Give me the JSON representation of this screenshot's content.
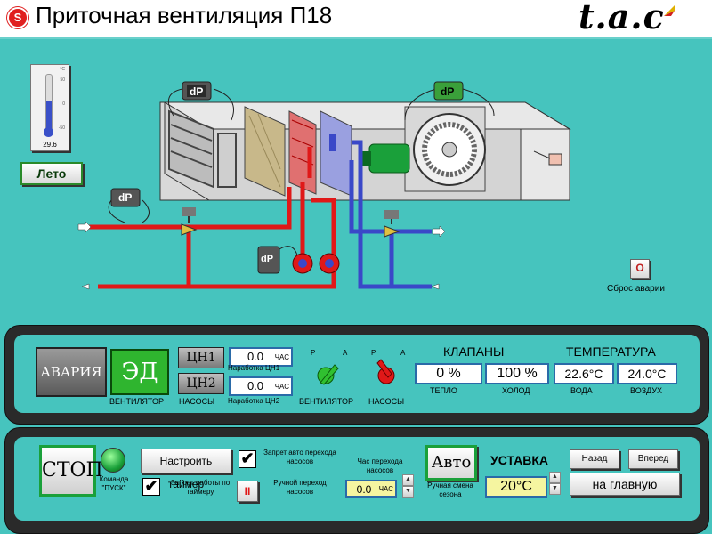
{
  "header": {
    "title": "Приточная  вентиляция П18",
    "logo_text": "t.a.c"
  },
  "thermometer": {
    "unit": "°C",
    "scale": [
      "50",
      "0",
      "-50"
    ],
    "value": "29.6"
  },
  "season_button": "Лето",
  "diagram": {
    "dp_label": "dP"
  },
  "alarm_reset": {
    "icon": "O",
    "label": "Сброс аварии"
  },
  "status_panel": {
    "alarm_button": "АВАРИЯ",
    "ed_button": "ЭД",
    "fan_label": "ВЕНТИЛЯТОР",
    "pump1": "ЦН1",
    "pump2": "ЦН2",
    "pumps_label": "НАСОСЫ",
    "runtime1_value": "0.0",
    "runtime1_unit": "ЧАС",
    "runtime1_label": "Наработка ЦН1",
    "runtime2_value": "0.0",
    "runtime2_unit": "ЧАС",
    "runtime2_label": "Наработка ЦН2",
    "fan_indicator": {
      "p": "P",
      "a": "A",
      "label": "ВЕНТИЛЯТОР"
    },
    "pump_indicator": {
      "p": "P",
      "a": "A",
      "label": "НАСОСЫ"
    },
    "valves_title": "КЛАПАНЫ",
    "valve_heat": "0 %",
    "valve_heat_label": "ТЕПЛО",
    "valve_cold": "100 %",
    "valve_cold_label": "ХОЛОД",
    "temp_title": "ТЕМПЕРАТУРА",
    "temp_water": "22.6°C",
    "temp_water_label": "ВОДА",
    "temp_air": "24.0°C",
    "temp_air_label": "ВОЗДУХ"
  },
  "control_panel": {
    "stop_button": "СТОП",
    "start_cmd_label": "Команда \"ПУСК\"",
    "timer_button": "Настроить таймер",
    "timer_block_label": "Запрет работы по таймеру",
    "auto_pump_block_label": "Запрет авто перехода насосов",
    "manual_pump_label": "Ручной переход насосов",
    "manual_pump_icon": "II",
    "switch_hour_title": "Час перехода насосов",
    "switch_hour_value": "0.0",
    "switch_hour_unit": "ЧАС",
    "auto_button": "Авто",
    "season_manual_label": "Ручная смена сезона",
    "setpoint_title": "УСТАВКА",
    "setpoint_value": "20°C",
    "back_button": "Назад",
    "forward_button": "Вперед",
    "main_button": "на главную"
  },
  "colors": {
    "background": "#46c4be",
    "hot_pipe": "#e01818",
    "cold_pipe": "#3a48c8",
    "ed_green": "#2fb52f"
  }
}
